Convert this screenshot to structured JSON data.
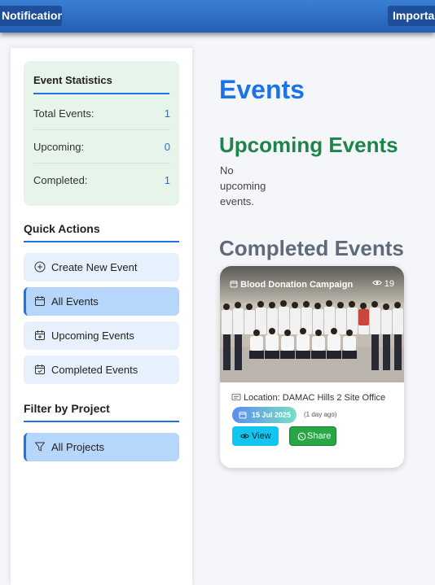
{
  "topbar": {
    "notifications_label": "Notifications",
    "important_label": "Important"
  },
  "stats": {
    "title": "Event Statistics",
    "rows": [
      {
        "label": "Total Events:",
        "value": "1"
      },
      {
        "label": "Upcoming:",
        "value": "0"
      },
      {
        "label": "Completed:",
        "value": "1"
      }
    ]
  },
  "quick_actions": {
    "title": "Quick Actions",
    "items": [
      {
        "label": "Create New Event",
        "icon": "plus-circle-icon"
      },
      {
        "label": "All Events",
        "icon": "calendar-icon"
      },
      {
        "label": "Upcoming Events",
        "icon": "calendar-plus-icon"
      },
      {
        "label": "Completed Events",
        "icon": "calendar-check-icon"
      }
    ]
  },
  "filter": {
    "title": "Filter by Project",
    "items": [
      {
        "label": "All Projects",
        "icon": "filter-icon"
      }
    ]
  },
  "main": {
    "title": "Events",
    "upcoming_title": "Upcoming Events",
    "no_upcoming": "No upcoming events.",
    "completed_title": "Completed Events"
  },
  "event_card": {
    "title": "Blood Donation Campaign",
    "views": "19",
    "location": "Location: DAMAC Hills 2 Site Office",
    "date": "15 Jul 2025",
    "ago": "(1 day ago)",
    "view_label": "View",
    "share_label": "Share"
  },
  "colors": {
    "accent": "#1a73e8",
    "upcoming": "#1e8449",
    "stats_bg": "#e6f4ea",
    "share": "#28a745",
    "view": "#11c5f0"
  }
}
